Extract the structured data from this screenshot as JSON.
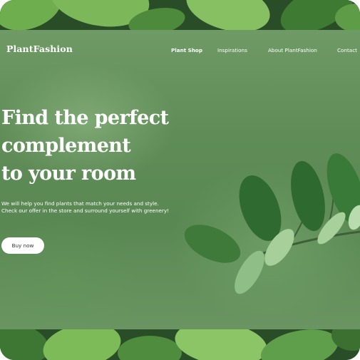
{
  "brand": {
    "name": "PlantFashion"
  },
  "nav": {
    "items": [
      {
        "label": "Plant Shop",
        "active": true
      },
      {
        "label": "Inspirations",
        "active": false
      },
      {
        "label": "About PlantFashion",
        "active": false
      },
      {
        "label": "Contact",
        "active": false
      }
    ]
  },
  "hero": {
    "headline_lines": [
      "Find the perfect",
      "complement",
      "to your room"
    ],
    "subtitle_lines": [
      "We will help you find plants that match your needs and style.",
      "Check our offer in the store and surround yourself with greenery!"
    ],
    "cta_label": "Buy now"
  },
  "colors": {
    "background_green": "#5f8c57",
    "leaf_dark": "#2f5a2d",
    "leaf_light": "#6fae4f",
    "text": "#ffffff",
    "button_bg": "#ffffff",
    "button_text": "#333333"
  },
  "icons": [
    "leaf-background-image",
    "leaf-branch-image"
  ]
}
